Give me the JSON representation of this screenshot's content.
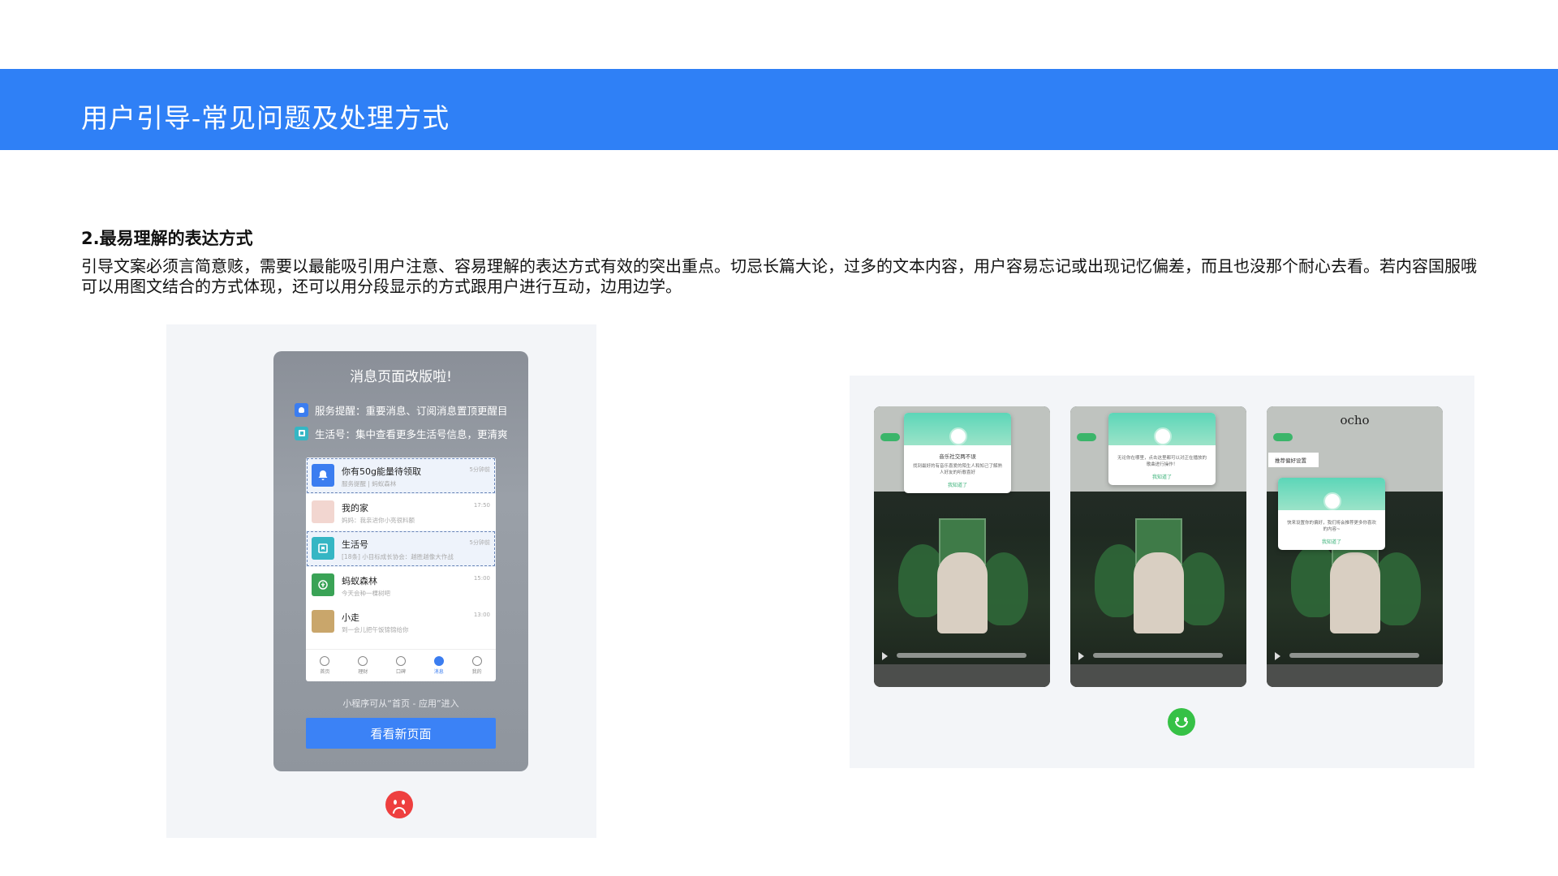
{
  "header": {
    "title": "用户引导-常见问题及处理方式"
  },
  "section": {
    "title": "2.最易理解的表达方式",
    "body": "引导文案必须言简意赅，需要以最能吸引用户注意、容易理解的表达方式有效的突出重点。切忌长篇大论，过多的文本内容，用户容易忘记或出现记忆偏差，而且也没那个耐心去看。若内容国服哦可以用图文结合的方式体现，还可以用分段显示的方式跟用户进行互动，边用边学。"
  },
  "left_example": {
    "modal_title": "消息页面改版啦!",
    "tips": [
      {
        "text": "服务提醒：重要消息、订阅消息置顶更醒目",
        "icon": "bell-icon"
      },
      {
        "text": "生活号：集中查看更多生活号信息，更清爽",
        "icon": "life-account-icon"
      }
    ],
    "messages": [
      {
        "name": "你有50g能量待领取",
        "sub": "服务提醒 | 蚂蚁森林",
        "time": "5分钟前",
        "highlight": true,
        "color": "#3b7df0"
      },
      {
        "name": "我的家",
        "sub": "妈妈：我亲进你小亮很料额",
        "time": "17:50",
        "highlight": false,
        "color": "#f2d6d0"
      },
      {
        "name": "生活号",
        "sub": "[18条] 小目标成长协会：越胜越像大作战",
        "time": "5分钟前",
        "highlight": true,
        "color": "#35b6c4"
      },
      {
        "name": "蚂蚁森林",
        "sub": "今天会种一棵树吧",
        "time": "15:00",
        "highlight": false,
        "color": "#3aa356"
      },
      {
        "name": "小走",
        "sub": "到一会儿把午饭锦锦给你",
        "time": "13:00",
        "highlight": false,
        "color": "#c9a66b"
      }
    ],
    "tabs": [
      {
        "label": "首页",
        "active": false
      },
      {
        "label": "理财",
        "active": false
      },
      {
        "label": "口碑",
        "active": false
      },
      {
        "label": "消息",
        "active": true
      },
      {
        "label": "我的",
        "active": false
      }
    ],
    "hint": "小程序可从“首页 - 应用”进入",
    "button": "看看新页面",
    "rating": "sad-face-icon"
  },
  "right_example": {
    "app_logo": "ocho",
    "setting_chip": "推荐偏好设置",
    "screens": [
      {
        "popup_title": "音乐社交两不误",
        "popup_text": "找到最好的有音乐喜爱的陌生人和知己了解熟人好友的听歌喜好",
        "popup_btn": "我知道了"
      },
      {
        "popup_title": "",
        "popup_text": "无论你在哪里，点击这里都可以对正在播放的歌曲进行操作！",
        "popup_btn": "我知道了"
      },
      {
        "popup_title": "",
        "popup_text": "快来设置你的偏好，我们将会推荐更多你喜欢的内容~",
        "popup_btn": "我知道了"
      }
    ],
    "rating": "happy-face-icon"
  },
  "colors": {
    "banner": "#2f80f6",
    "cta": "#3b82f6",
    "sad": "#ee3f3f",
    "happy": "#36c146"
  }
}
